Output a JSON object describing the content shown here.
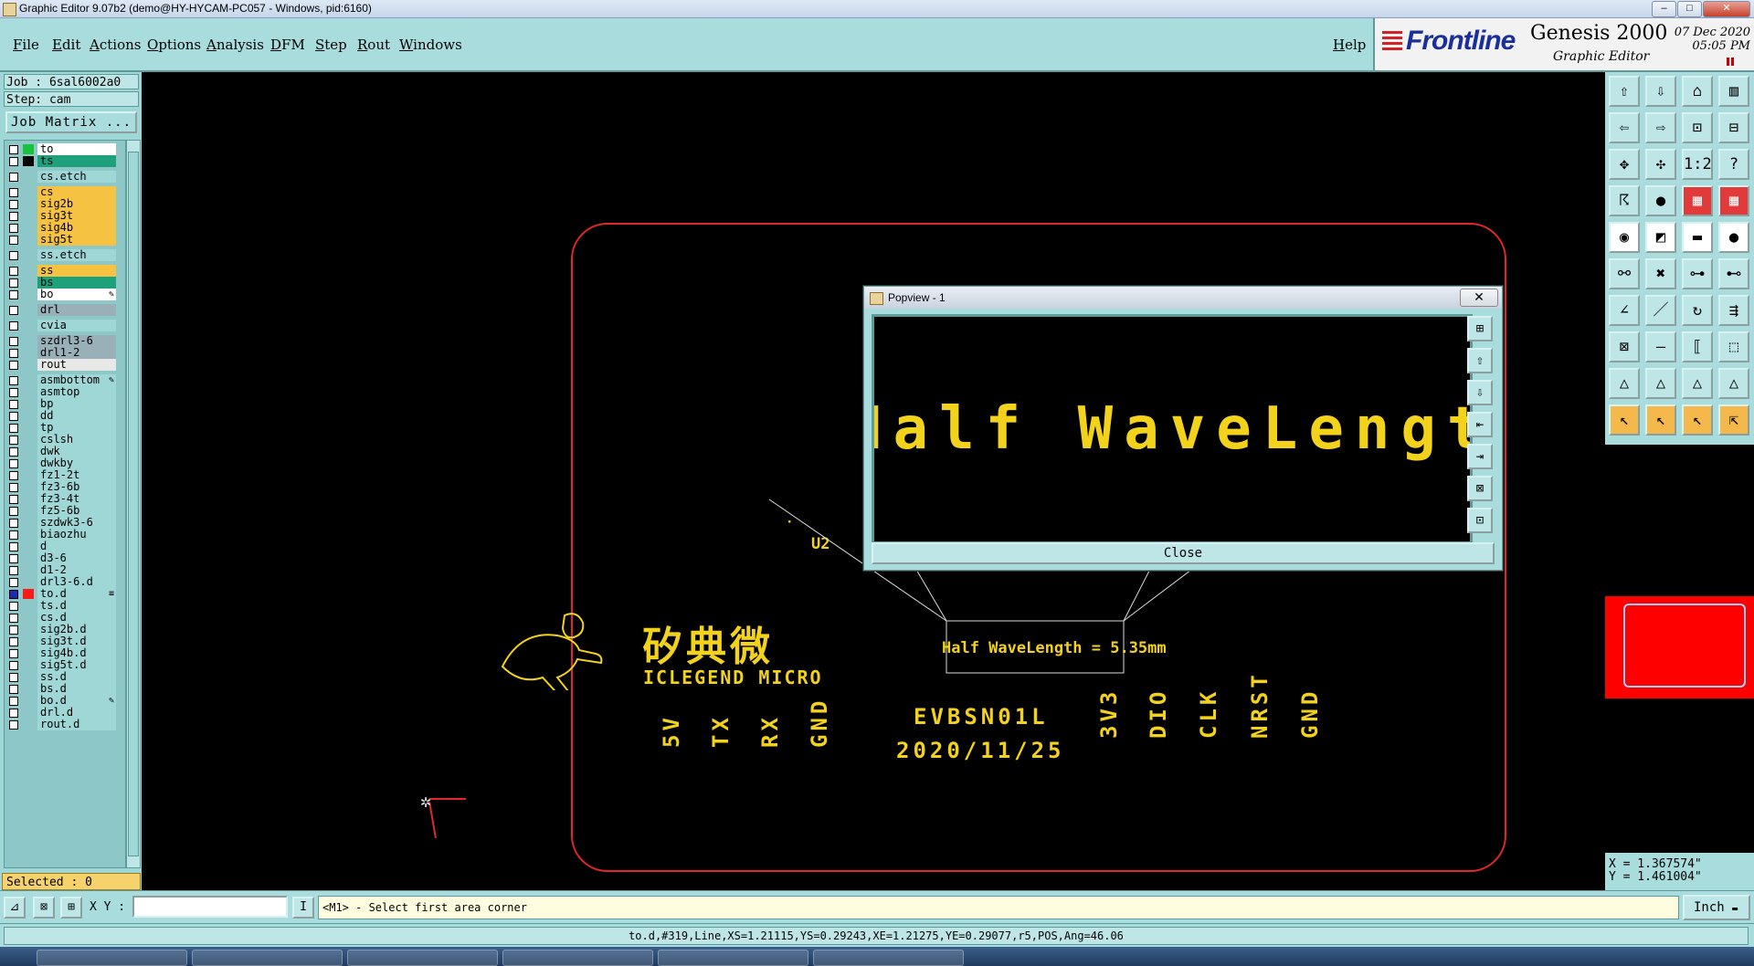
{
  "window": {
    "title": "Graphic Editor 9.07b2 (demo@HY-HYCAM-PC057 - Windows, pid:6160)",
    "controls": [
      "–",
      "□",
      "✕"
    ]
  },
  "menu": {
    "items": [
      "File",
      "Edit",
      "Actions",
      "Options",
      "Analysis",
      "DFM",
      "Step",
      "Rout",
      "Windows"
    ],
    "help": "Help"
  },
  "brand": {
    "logo": "Frontline",
    "product": "Genesis 2000",
    "subtitle": "Graphic Editor",
    "date": "07 Dec 2020",
    "time": "05:05 PM"
  },
  "job": {
    "job_label": "Job : 6sal6002a0",
    "step_label": "Step: cam",
    "matrix_button": "Job Matrix ..."
  },
  "layers": [
    {
      "name": "to",
      "bg": "#ffffff",
      "swatch": "#18c23a",
      "checked": false
    },
    {
      "name": "ts",
      "bg": "#1ea07a",
      "swatch": "#000000",
      "checked": false
    },
    {
      "name": "cs.etch",
      "bg": "#9fd6d6",
      "swatch": "",
      "checked": false
    },
    {
      "name": "cs",
      "bg": "#f5c242",
      "swatch": "",
      "checked": false
    },
    {
      "name": "sig2b",
      "bg": "#f5c242",
      "swatch": "",
      "checked": false
    },
    {
      "name": "sig3t",
      "bg": "#f5c242",
      "swatch": "",
      "checked": false
    },
    {
      "name": "sig4b",
      "bg": "#f5c242",
      "swatch": "",
      "checked": false
    },
    {
      "name": "sig5t",
      "bg": "#f5c242",
      "swatch": "",
      "checked": false
    },
    {
      "name": "ss.etch",
      "bg": "#9fd6d6",
      "swatch": "",
      "checked": false
    },
    {
      "name": "ss",
      "bg": "#f5c242",
      "swatch": "",
      "checked": false
    },
    {
      "name": "bs",
      "bg": "#1ea07a",
      "swatch": "",
      "checked": false
    },
    {
      "name": "bo",
      "bg": "#ffffff",
      "swatch": "",
      "checked": false,
      "pen": true
    },
    {
      "name": "drl",
      "bg": "#9ab0b8",
      "swatch": "",
      "checked": false
    },
    {
      "name": "cvia",
      "bg": "#9fd6d6",
      "swatch": "",
      "checked": false
    },
    {
      "name": "szdrl3-6",
      "bg": "#9ab0b8",
      "swatch": "",
      "checked": false
    },
    {
      "name": "drl1-2",
      "bg": "#9ab0b8",
      "swatch": "",
      "checked": false
    },
    {
      "name": "rout",
      "bg": "#e8e8e8",
      "swatch": "",
      "checked": false
    },
    {
      "name": "asmbottom",
      "bg": "#9fd6d6",
      "swatch": "",
      "checked": false,
      "pen": true
    },
    {
      "name": "asmtop",
      "bg": "#9fd6d6",
      "swatch": "",
      "checked": false
    },
    {
      "name": "bp",
      "bg": "#9fd6d6",
      "swatch": "",
      "checked": false
    },
    {
      "name": "dd",
      "bg": "#9fd6d6",
      "swatch": "",
      "checked": false
    },
    {
      "name": "tp",
      "bg": "#9fd6d6",
      "swatch": "",
      "checked": false
    },
    {
      "name": "cslsh",
      "bg": "#9fd6d6",
      "swatch": "",
      "checked": false
    },
    {
      "name": "dwk",
      "bg": "#9fd6d6",
      "swatch": "",
      "checked": false
    },
    {
      "name": "dwkby",
      "bg": "#9fd6d6",
      "swatch": "",
      "checked": false
    },
    {
      "name": "fz1-2t",
      "bg": "#9fd6d6",
      "swatch": "",
      "checked": false
    },
    {
      "name": "fz3-6b",
      "bg": "#9fd6d6",
      "swatch": "",
      "checked": false
    },
    {
      "name": "fz3-4t",
      "bg": "#9fd6d6",
      "swatch": "",
      "checked": false
    },
    {
      "name": "fz5-6b",
      "bg": "#9fd6d6",
      "swatch": "",
      "checked": false
    },
    {
      "name": "szdwk3-6",
      "bg": "#9fd6d6",
      "swatch": "",
      "checked": false
    },
    {
      "name": "biaozhu",
      "bg": "#9fd6d6",
      "swatch": "",
      "checked": false
    },
    {
      "name": "d",
      "bg": "#9fd6d6",
      "swatch": "",
      "checked": false
    },
    {
      "name": "d3-6",
      "bg": "#9fd6d6",
      "swatch": "",
      "checked": false
    },
    {
      "name": "d1-2",
      "bg": "#9fd6d6",
      "swatch": "",
      "checked": false
    },
    {
      "name": "drl3-6.d",
      "bg": "#9fd6d6",
      "swatch": "",
      "checked": false
    },
    {
      "name": "to.d",
      "bg": "#9fd6d6",
      "swatch": "#ff1a1a",
      "checked": true,
      "mark": "≡"
    },
    {
      "name": "ts.d",
      "bg": "#9fd6d6",
      "swatch": "",
      "checked": false
    },
    {
      "name": "cs.d",
      "bg": "#9fd6d6",
      "swatch": "",
      "checked": false
    },
    {
      "name": "sig2b.d",
      "bg": "#9fd6d6",
      "swatch": "",
      "checked": false
    },
    {
      "name": "sig3t.d",
      "bg": "#9fd6d6",
      "swatch": "",
      "checked": false
    },
    {
      "name": "sig4b.d",
      "bg": "#9fd6d6",
      "swatch": "",
      "checked": false
    },
    {
      "name": "sig5t.d",
      "bg": "#9fd6d6",
      "swatch": "",
      "checked": false
    },
    {
      "name": "ss.d",
      "bg": "#9fd6d6",
      "swatch": "",
      "checked": false
    },
    {
      "name": "bs.d",
      "bg": "#9fd6d6",
      "swatch": "",
      "checked": false
    },
    {
      "name": "bo.d",
      "bg": "#9fd6d6",
      "swatch": "",
      "checked": false,
      "pen": true
    },
    {
      "name": "drl.d",
      "bg": "#9fd6d6",
      "swatch": "",
      "checked": false
    },
    {
      "name": "rout.d",
      "bg": "#9fd6d6",
      "swatch": "",
      "checked": false
    }
  ],
  "selected": "Selected : 0",
  "board": {
    "ref_u2": "U2",
    "brand_cn": "矽典微",
    "brand_en": "ICLEGEND MICRO",
    "pins_left": [
      "5V",
      "TX",
      "RX",
      "GND"
    ],
    "pins_right": [
      "3V3",
      "DIO",
      "CLK",
      "NRST",
      "GND"
    ],
    "model": "EVBSN01L",
    "date": "2020/11/25",
    "zoom_text": "Half WaveLength = 5.35mm"
  },
  "popview": {
    "title": "Popview - 1",
    "close_x": "✕",
    "magnified_text": "Half WaveLength =",
    "close_button": "Close"
  },
  "coords": {
    "x": "X = 1.367574\"",
    "y": "Y = 1.461004\""
  },
  "command": {
    "xy_label": "X Y :",
    "xy_value": "",
    "prompt": "<M1> - Select first area corner",
    "unit": "Inch"
  },
  "status": "to.d,#319,Line,XS=1.21115,YS=0.29243,XE=1.21275,YE=0.29077,r5,POS,Ang=46.06",
  "colors": {
    "panel": "#a9dcdc",
    "silkscreen": "#f2d21b",
    "board_outline": "#e02828",
    "navigator": "#ff0000"
  },
  "toolbar_icons": [
    "open-icon",
    "save-icon",
    "home-icon",
    "layout-icon",
    "zoom-in-icon",
    "zoom-out-icon",
    "zoom-area-icon",
    "zoom-fit-icon",
    "zoom-home-icon",
    "pan-icon",
    "scale-1-2-icon",
    "help-icon",
    "helicopter-icon",
    "pin-icon",
    "layers-a-icon",
    "layers-b-icon",
    "snap-icon",
    "display-icon",
    "measure-icon",
    "pad-icon",
    "connect-icon",
    "cross-icon",
    "node-a-icon",
    "node-b-icon",
    "line-a-icon",
    "line-b-icon",
    "arc-icon",
    "route-icon",
    "move-icon",
    "dash-icon",
    "bracket-icon",
    "grid-icon",
    "triangle-a-icon",
    "triangle-b-icon",
    "triangle-c-icon",
    "triangle-d-icon",
    "select-icon",
    "select-area-icon",
    "select-inside-icon",
    "select-multi-icon"
  ],
  "toolbar_glyphs": [
    "⇧",
    "⇩",
    "⌂",
    "▥",
    "⇦",
    "⇨",
    "⊡",
    "⊟",
    "✥",
    "✣",
    "1:2",
    "?",
    "☈",
    "●",
    "▦",
    "▦",
    "◉",
    "◩",
    "▬",
    "●",
    "⚯",
    "✖",
    "⊶",
    "⊷",
    "∠",
    "／",
    "↻",
    "⇶",
    "⊠",
    "—",
    "⟦",
    "⬚",
    "△",
    "△",
    "△",
    "△",
    "↖",
    "↖",
    "↖",
    "⇱"
  ],
  "popview_tools": [
    "⊞",
    "⇧",
    "⇩",
    "⇤",
    "⇥",
    "⊠",
    "⊡"
  ]
}
